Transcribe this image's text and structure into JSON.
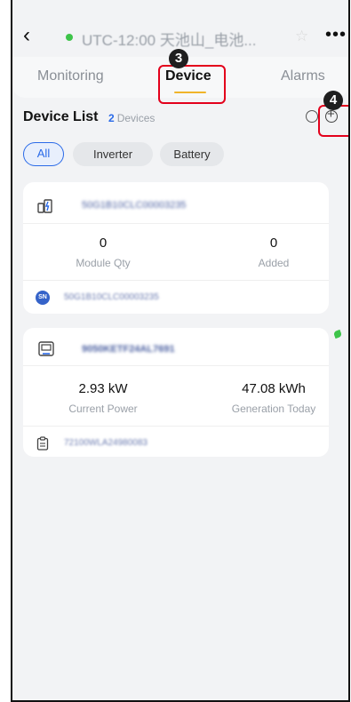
{
  "header": {
    "back_icon": "chevron-left-icon",
    "status_color": "#3ec44a",
    "site_title": "UTC-12:00 天池山_电池...",
    "star_icon": "star-icon",
    "more_icon": "more-icon"
  },
  "tabs": [
    {
      "label": "Monitoring"
    },
    {
      "label": "Device"
    },
    {
      "label": "Alarms"
    }
  ],
  "annotations": {
    "device_tab": "3",
    "add_button": "4"
  },
  "device_list": {
    "title": "Device List",
    "count": "2",
    "count_suffix": "Devices",
    "filters": [
      {
        "label": "All",
        "active": true
      },
      {
        "label": "Inverter",
        "active": false
      },
      {
        "label": "Battery",
        "active": false
      }
    ]
  },
  "devices": [
    {
      "icon": "battery-module-icon",
      "id": "50G1B10CLC00003235",
      "stats": [
        {
          "value": "0",
          "label": "Module Qty"
        },
        {
          "value": "0",
          "label": "Added"
        }
      ],
      "sub_badge": "SN",
      "sub_id": "50G1B10CLC00003235"
    },
    {
      "icon": "inverter-icon",
      "id": "9050KETF24AL7691",
      "stats": [
        {
          "value": "2.93 kW",
          "label": "Current Power"
        },
        {
          "value": "47.08 kWh",
          "label": "Generation Today"
        }
      ],
      "sub_icon": "clipboard-icon",
      "sub_id": "72100WLA24980083"
    }
  ],
  "colors": {
    "accent": "#2a6ae8",
    "annotation": "#e3001b",
    "tab_underline": "#f0b429"
  }
}
